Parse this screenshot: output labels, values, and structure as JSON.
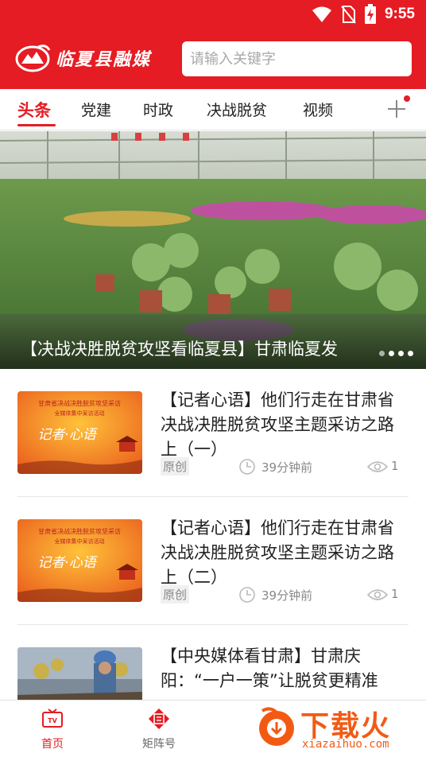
{
  "status_bar": {
    "time": "9:55"
  },
  "header": {
    "app_name": "临夏县融媒",
    "search_placeholder": "请输入关键字"
  },
  "tabs": [
    {
      "label": "头条",
      "active": true
    },
    {
      "label": "党建"
    },
    {
      "label": "时政"
    },
    {
      "label": "决战脱贫"
    },
    {
      "label": "视频"
    }
  ],
  "banner": {
    "caption": "【决战决胜脱贫攻坚看临夏县】甘肃临夏发",
    "slides": 4,
    "current_slide": 1
  },
  "thumb_text": {
    "line1": "甘肃省决战决胜脱贫攻坚采访",
    "line2": "全媒体集中采访活动",
    "line3": "记者·心语"
  },
  "news": [
    {
      "title": "【记者心语】他们行走在甘肃省决战决胜脱贫攻坚主题采访之路上（一）",
      "tag": "原创",
      "time": "39分钟前",
      "views": "1"
    },
    {
      "title": "【记者心语】他们行走在甘肃省决战决胜脱贫攻坚主题采访之路上（二）",
      "tag": "原创",
      "time": "39分钟前",
      "views": "1"
    },
    {
      "title": "【中央媒体看甘肃】甘肃庆阳：“一户一策”让脱贫更精准"
    }
  ],
  "bottom_nav": [
    {
      "label": "首页",
      "active": true
    },
    {
      "label": "矩阵号"
    }
  ],
  "watermark": {
    "text": "下载火",
    "sub": "xiazaihuo.com"
  },
  "colors": {
    "brand_red": "#e51c23",
    "watermark_orange": "#f25a14"
  }
}
